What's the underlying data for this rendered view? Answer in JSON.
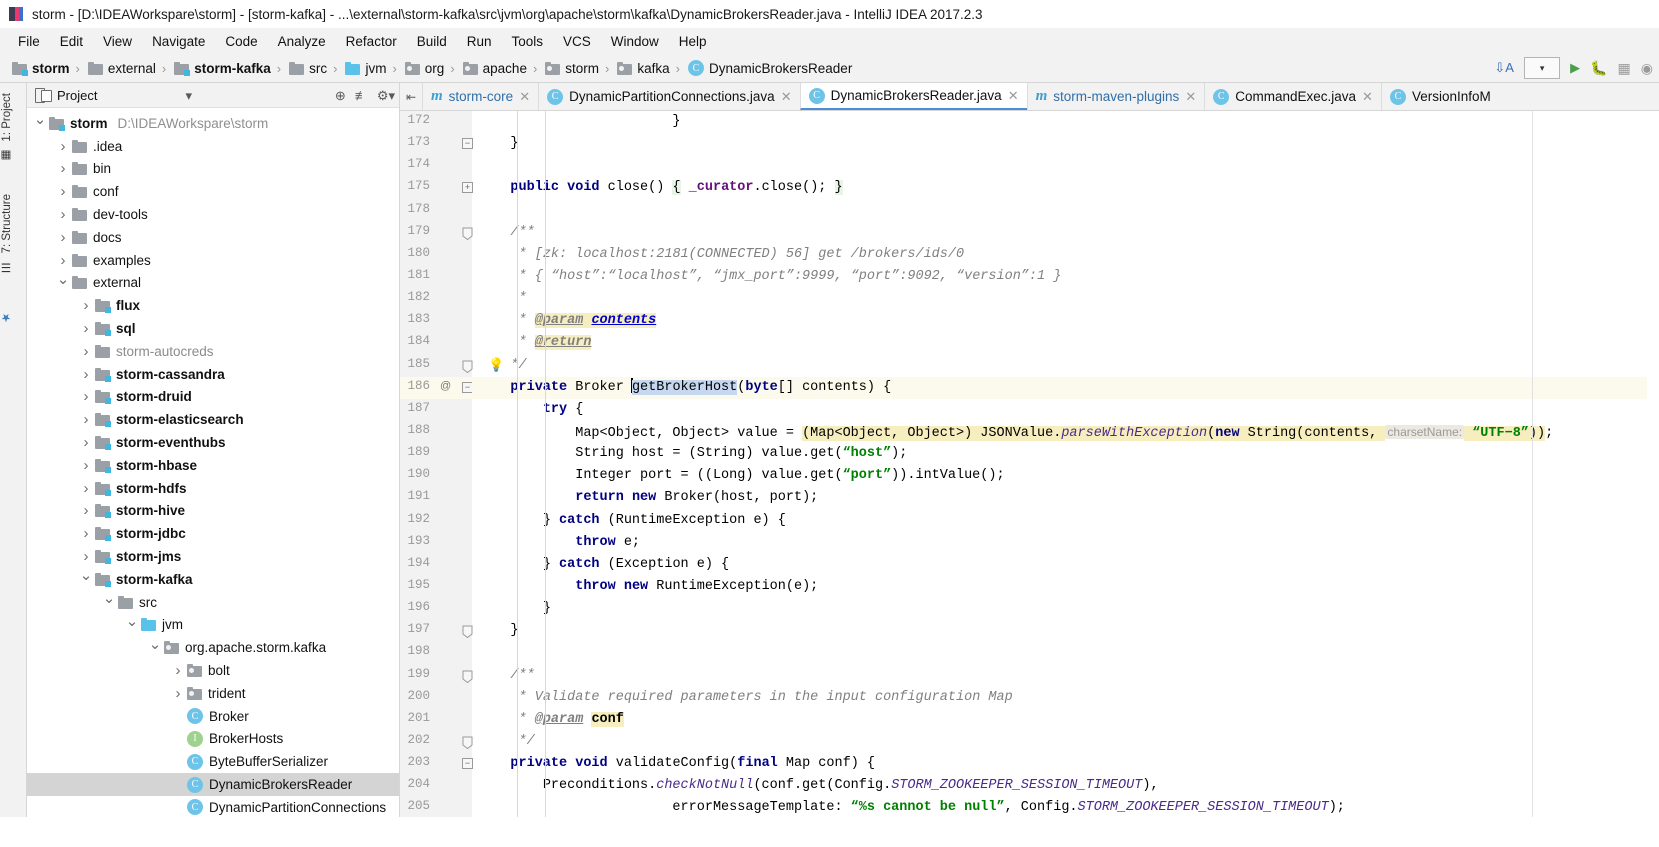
{
  "window": {
    "title": "storm - [D:\\IDEAWorkspare\\storm] - [storm-kafka] - ...\\external\\storm-kafka\\src\\jvm\\org\\apache\\storm\\kafka\\DynamicBrokersReader.java - IntelliJ IDEA 2017.2.3",
    "app_icon": "intellij-idea-icon"
  },
  "menubar": {
    "items": [
      {
        "label": "File"
      },
      {
        "label": "Edit"
      },
      {
        "label": "View"
      },
      {
        "label": "Navigate"
      },
      {
        "label": "Code"
      },
      {
        "label": "Analyze"
      },
      {
        "label": "Refactor"
      },
      {
        "label": "Build"
      },
      {
        "label": "Run"
      },
      {
        "label": "Tools"
      },
      {
        "label": "VCS"
      },
      {
        "label": "Window"
      },
      {
        "label": "Help"
      }
    ]
  },
  "breadcrumb": {
    "items": [
      {
        "label": "storm",
        "icon": "module-folder-icon",
        "bold": true
      },
      {
        "label": "external",
        "icon": "folder-icon",
        "bold": false
      },
      {
        "label": "storm-kafka",
        "icon": "module-folder-icon",
        "bold": true
      },
      {
        "label": "src",
        "icon": "folder-icon",
        "bold": false
      },
      {
        "label": "jvm",
        "icon": "source-folder-icon",
        "bold": false
      },
      {
        "label": "org",
        "icon": "package-icon",
        "bold": false
      },
      {
        "label": "apache",
        "icon": "package-icon",
        "bold": false
      },
      {
        "label": "storm",
        "icon": "package-icon",
        "bold": false
      },
      {
        "label": "kafka",
        "icon": "package-icon",
        "bold": false
      },
      {
        "label": "DynamicBrokersReader",
        "icon": "class-icon",
        "bold": false
      }
    ],
    "separator": "›",
    "toolbar": {
      "sort_icon": "sort-alphabetically-icon",
      "combo_icon": "chevron-down-icon",
      "run_icon": "run-icon",
      "debug_icon": "debug-icon",
      "coverage_icon": "run-with-coverage-icon",
      "profile_icon": "profile-icon"
    }
  },
  "left_tool_strip": {
    "tabs": [
      {
        "label": "1: Project",
        "icon": "project-tool-icon"
      },
      {
        "label": "7: Structure",
        "icon": "structure-tool-icon"
      },
      {
        "label": "",
        "icon": "favorites-tool-icon"
      }
    ]
  },
  "project_panel": {
    "header": {
      "title": "Project",
      "view_icon": "project-view-icon",
      "dropdown_icon": "chevron-down-icon",
      "locate_icon": "scroll-from-source-icon",
      "collapse_icon": "collapse-all-icon",
      "settings_icon": "gear-icon"
    },
    "tree": [
      {
        "label": "storm",
        "path": "D:\\IDEAWorkspare\\storm",
        "indent": 0,
        "arrow": "open",
        "icon": "module-folder-icon",
        "bold": true,
        "selected": false
      },
      {
        "label": ".idea",
        "indent": 1,
        "arrow": "closed",
        "icon": "folder-icon",
        "bold": false,
        "selected": false
      },
      {
        "label": "bin",
        "indent": 1,
        "arrow": "closed",
        "icon": "folder-icon",
        "bold": false,
        "selected": false
      },
      {
        "label": "conf",
        "indent": 1,
        "arrow": "closed",
        "icon": "folder-icon",
        "bold": false,
        "selected": false
      },
      {
        "label": "dev-tools",
        "indent": 1,
        "arrow": "closed",
        "icon": "folder-icon",
        "bold": false,
        "selected": false
      },
      {
        "label": "docs",
        "indent": 1,
        "arrow": "closed",
        "icon": "folder-icon",
        "bold": false,
        "selected": false
      },
      {
        "label": "examples",
        "indent": 1,
        "arrow": "closed",
        "icon": "folder-icon",
        "bold": false,
        "selected": false
      },
      {
        "label": "external",
        "indent": 1,
        "arrow": "open",
        "icon": "folder-icon",
        "bold": false,
        "selected": false
      },
      {
        "label": "flux",
        "indent": 2,
        "arrow": "closed",
        "icon": "module-folder-icon",
        "bold": true,
        "selected": false
      },
      {
        "label": "sql",
        "indent": 2,
        "arrow": "closed",
        "icon": "module-folder-icon",
        "bold": true,
        "selected": false
      },
      {
        "label": "storm-autocreds",
        "indent": 2,
        "arrow": "closed",
        "icon": "folder-icon",
        "bold": false,
        "dim": true,
        "selected": false
      },
      {
        "label": "storm-cassandra",
        "indent": 2,
        "arrow": "closed",
        "icon": "module-folder-icon",
        "bold": true,
        "selected": false
      },
      {
        "label": "storm-druid",
        "indent": 2,
        "arrow": "closed",
        "icon": "module-folder-icon",
        "bold": true,
        "selected": false
      },
      {
        "label": "storm-elasticsearch",
        "indent": 2,
        "arrow": "closed",
        "icon": "module-folder-icon",
        "bold": true,
        "selected": false
      },
      {
        "label": "storm-eventhubs",
        "indent": 2,
        "arrow": "closed",
        "icon": "module-folder-icon",
        "bold": true,
        "selected": false
      },
      {
        "label": "storm-hbase",
        "indent": 2,
        "arrow": "closed",
        "icon": "module-folder-icon",
        "bold": true,
        "selected": false
      },
      {
        "label": "storm-hdfs",
        "indent": 2,
        "arrow": "closed",
        "icon": "module-folder-icon",
        "bold": true,
        "selected": false
      },
      {
        "label": "storm-hive",
        "indent": 2,
        "arrow": "closed",
        "icon": "module-folder-icon",
        "bold": true,
        "selected": false
      },
      {
        "label": "storm-jdbc",
        "indent": 2,
        "arrow": "closed",
        "icon": "module-folder-icon",
        "bold": true,
        "selected": false
      },
      {
        "label": "storm-jms",
        "indent": 2,
        "arrow": "closed",
        "icon": "module-folder-icon",
        "bold": true,
        "selected": false
      },
      {
        "label": "storm-kafka",
        "indent": 2,
        "arrow": "open",
        "icon": "module-folder-icon",
        "bold": true,
        "selected": false
      },
      {
        "label": "src",
        "indent": 3,
        "arrow": "open",
        "icon": "folder-icon",
        "bold": false,
        "selected": false
      },
      {
        "label": "jvm",
        "indent": 4,
        "arrow": "open",
        "icon": "source-folder-icon",
        "bold": false,
        "selected": false
      },
      {
        "label": "org.apache.storm.kafka",
        "indent": 5,
        "arrow": "open",
        "icon": "package-icon",
        "bold": false,
        "selected": false
      },
      {
        "label": "bolt",
        "indent": 6,
        "arrow": "closed",
        "icon": "package-icon",
        "bold": false,
        "selected": false
      },
      {
        "label": "trident",
        "indent": 6,
        "arrow": "closed",
        "icon": "package-icon",
        "bold": false,
        "selected": false
      },
      {
        "label": "Broker",
        "indent": 6,
        "arrow": "none",
        "icon": "class-icon",
        "bold": false,
        "selected": false
      },
      {
        "label": "BrokerHosts",
        "indent": 6,
        "arrow": "none",
        "icon": "interface-icon",
        "bold": false,
        "selected": false
      },
      {
        "label": "ByteBufferSerializer",
        "indent": 6,
        "arrow": "none",
        "icon": "class-icon",
        "bold": false,
        "selected": false
      },
      {
        "label": "DynamicBrokersReader",
        "indent": 6,
        "arrow": "none",
        "icon": "class-icon",
        "bold": false,
        "selected": true
      },
      {
        "label": "DynamicPartitionConnections",
        "indent": 6,
        "arrow": "none",
        "icon": "class-icon",
        "bold": false,
        "selected": false
      }
    ]
  },
  "editor_tabs": {
    "pin_icon": "pin-tab-icon",
    "tabs": [
      {
        "label": "storm-core",
        "icon": "maven-icon",
        "active": false,
        "closable": true
      },
      {
        "label": "DynamicPartitionConnections.java",
        "icon": "class-icon",
        "active": false,
        "closable": true
      },
      {
        "label": "DynamicBrokersReader.java",
        "icon": "class-icon",
        "active": true,
        "closable": true
      },
      {
        "label": "storm-maven-plugins",
        "icon": "maven-icon",
        "active": false,
        "closable": true
      },
      {
        "label": "CommandExec.java",
        "icon": "class-icon",
        "active": false,
        "closable": true
      },
      {
        "label": "VersionInfoM",
        "icon": "class-icon",
        "active": false,
        "closable": false
      }
    ]
  },
  "code": {
    "lines": [
      {
        "num": "172",
        "fold": "",
        "mark": "",
        "bulb": false,
        "hl": false,
        "html": "                <span class=\"ind\" style=\"left:45px\"></span>        }"
      },
      {
        "num": "173",
        "fold": "minus",
        "mark": "",
        "bulb": false,
        "hl": false,
        "html": "    }"
      },
      {
        "num": "174",
        "fold": "",
        "mark": "",
        "bulb": false,
        "hl": false,
        "html": ""
      },
      {
        "num": "175",
        "fold": "plus",
        "mark": "",
        "bulb": false,
        "hl": false,
        "html": "    <span class=\"kw\">public</span> <span class=\"kw\">void</span> close() <span class=\"hlgreen\">{</span> <span class=\"fld\">_curator</span>.close(); <span class=\"hlgreen\">}</span>"
      },
      {
        "num": "178",
        "fold": "",
        "mark": "",
        "bulb": false,
        "hl": false,
        "html": ""
      },
      {
        "num": "179",
        "fold": "tri",
        "mark": "",
        "bulb": false,
        "hl": false,
        "html": "    <span class=\"cm\">/**</span>"
      },
      {
        "num": "180",
        "fold": "",
        "mark": "",
        "bulb": false,
        "hl": false,
        "html": "     <span class=\"cm\">* [zk: localhost:2181(CONNECTED) 56] get /brokers/ids/0</span>"
      },
      {
        "num": "181",
        "fold": "",
        "mark": "",
        "bulb": false,
        "hl": false,
        "html": "     <span class=\"cm\">* { “host”:“localhost”, “jmx_port”:9999, “port”:9092, “version”:1 }</span>"
      },
      {
        "num": "182",
        "fold": "",
        "mark": "",
        "bulb": false,
        "hl": false,
        "html": "     <span class=\"cm\">*</span>"
      },
      {
        "num": "183",
        "fold": "",
        "mark": "",
        "bulb": false,
        "hl": false,
        "html": "     <span class=\"cm\">* </span><span class=\"tag hlyellow\">@param</span><span class=\"hlyellow\"> </span><span class=\"linkpar hlyellow\">contents</span>"
      },
      {
        "num": "184",
        "fold": "",
        "mark": "",
        "bulb": false,
        "hl": false,
        "html": "     <span class=\"cm\">* </span><span class=\"tag hlyellow\">@return</span>"
      },
      {
        "num": "185",
        "fold": "tri",
        "mark": "",
        "bulb": true,
        "hl": false,
        "html": "    <span class=\"cm\">*/</span>"
      },
      {
        "num": "186",
        "fold": "minus",
        "mark": "@",
        "bulb": false,
        "hl": true,
        "html": "    <span class=\"kw\">private</span> Broker <span class=\"caret\"></span><span class=\"selblue\">getBrokerHost</span>(<span class=\"kw\">byte</span>[] contents) {"
      },
      {
        "num": "187",
        "fold": "",
        "mark": "",
        "bulb": false,
        "hl": false,
        "html": "        <span class=\"ind\" style=\"left:45px\"></span><span class=\"kw\">try</span> {"
      },
      {
        "num": "188",
        "fold": "",
        "mark": "",
        "bulb": false,
        "hl": false,
        "html": "            <span class=\"ind\" style=\"left:45px\"></span><span class=\"ind\" style=\"left:73px\"></span>Map&lt;Object, Object&gt; value = <span class=\"hlyellow\">(Map&lt;Object, Object&gt;) JSONValue.<span class=\"stat\">parseWithException</span>(<span class=\"kw\">new</span> String(contents, </span><span class=\"hint\">charsetName:</span><span class=\"hlyellow\"> <span class=\"str\">“UTF−8”</span>))</span>;"
      },
      {
        "num": "189",
        "fold": "",
        "mark": "",
        "bulb": false,
        "hl": false,
        "html": "            <span class=\"ind\" style=\"left:45px\"></span><span class=\"ind\" style=\"left:73px\"></span>String host = (String) value.get(<span class=\"str\">“host”</span>);"
      },
      {
        "num": "190",
        "fold": "",
        "mark": "",
        "bulb": false,
        "hl": false,
        "html": "            <span class=\"ind\" style=\"left:45px\"></span><span class=\"ind\" style=\"left:73px\"></span>Integer port = ((Long) value.get(<span class=\"str\">“port”</span>)).intValue();"
      },
      {
        "num": "191",
        "fold": "",
        "mark": "",
        "bulb": false,
        "hl": false,
        "html": "            <span class=\"ind\" style=\"left:45px\"></span><span class=\"ind\" style=\"left:73px\"></span><span class=\"kw\">return</span> <span class=\"kw\">new</span> Broker(host, port);"
      },
      {
        "num": "192",
        "fold": "",
        "mark": "",
        "bulb": false,
        "hl": false,
        "html": "        <span class=\"ind\" style=\"left:45px\"></span>} <span class=\"kw\">catch</span> (RuntimeException e) {"
      },
      {
        "num": "193",
        "fold": "",
        "mark": "",
        "bulb": false,
        "hl": false,
        "html": "            <span class=\"ind\" style=\"left:45px\"></span><span class=\"ind\" style=\"left:73px\"></span><span class=\"kw\">throw</span> e;"
      },
      {
        "num": "194",
        "fold": "",
        "mark": "",
        "bulb": false,
        "hl": false,
        "html": "        <span class=\"ind\" style=\"left:45px\"></span>} <span class=\"kw\">catch</span> (Exception e) {"
      },
      {
        "num": "195",
        "fold": "",
        "mark": "",
        "bulb": false,
        "hl": false,
        "html": "            <span class=\"ind\" style=\"left:45px\"></span><span class=\"ind\" style=\"left:73px\"></span><span class=\"kw\">throw</span> <span class=\"kw\">new</span> RuntimeException(e);"
      },
      {
        "num": "196",
        "fold": "",
        "mark": "",
        "bulb": false,
        "hl": false,
        "html": "        <span class=\"ind\" style=\"left:45px\"></span>}"
      },
      {
        "num": "197",
        "fold": "tri",
        "mark": "",
        "bulb": false,
        "hl": false,
        "html": "    }"
      },
      {
        "num": "198",
        "fold": "",
        "mark": "",
        "bulb": false,
        "hl": false,
        "html": ""
      },
      {
        "num": "199",
        "fold": "tri",
        "mark": "",
        "bulb": false,
        "hl": false,
        "html": "    <span class=\"cm\">/**</span>"
      },
      {
        "num": "200",
        "fold": "",
        "mark": "",
        "bulb": false,
        "hl": false,
        "html": "     <span class=\"cm\">* Validate required parameters in the input configuration Map</span>"
      },
      {
        "num": "201",
        "fold": "",
        "mark": "",
        "bulb": false,
        "hl": false,
        "html": "     <span class=\"cm\">* </span><span class=\"tag\">@param</span><span class=\"cm\"> </span><span class=\"hlyellow\" style=\"font-weight:bold\">conf</span>"
      },
      {
        "num": "202",
        "fold": "tri",
        "mark": "",
        "bulb": false,
        "hl": false,
        "html": "     <span class=\"cm\">*/</span>"
      },
      {
        "num": "203",
        "fold": "minus",
        "mark": "",
        "bulb": false,
        "hl": false,
        "html": "    <span class=\"kw\">private</span> <span class=\"kw\">void</span> validateConfig(<span class=\"kw\">final</span> Map conf) {"
      },
      {
        "num": "204",
        "fold": "",
        "mark": "",
        "bulb": false,
        "hl": false,
        "html": "        <span class=\"ind\" style=\"left:45px\"></span>Preconditions.<span class=\"stat\">checkNotNull</span>(conf.get(Config.<span class=\"stat\">STORM_ZOOKEEPER_SESSION_TIMEOUT</span>),"
      },
      {
        "num": "205",
        "fold": "",
        "mark": "",
        "bulb": false,
        "hl": false,
        "html": "                <span class=\"ind\" style=\"left:45px\"></span>        errorMessageTemplate: <span class=\"str\">“%s cannot be null”</span>, Config.<span class=\"stat\">STORM_ZOOKEEPER_SESSION_TIMEOUT</span>);"
      }
    ]
  }
}
